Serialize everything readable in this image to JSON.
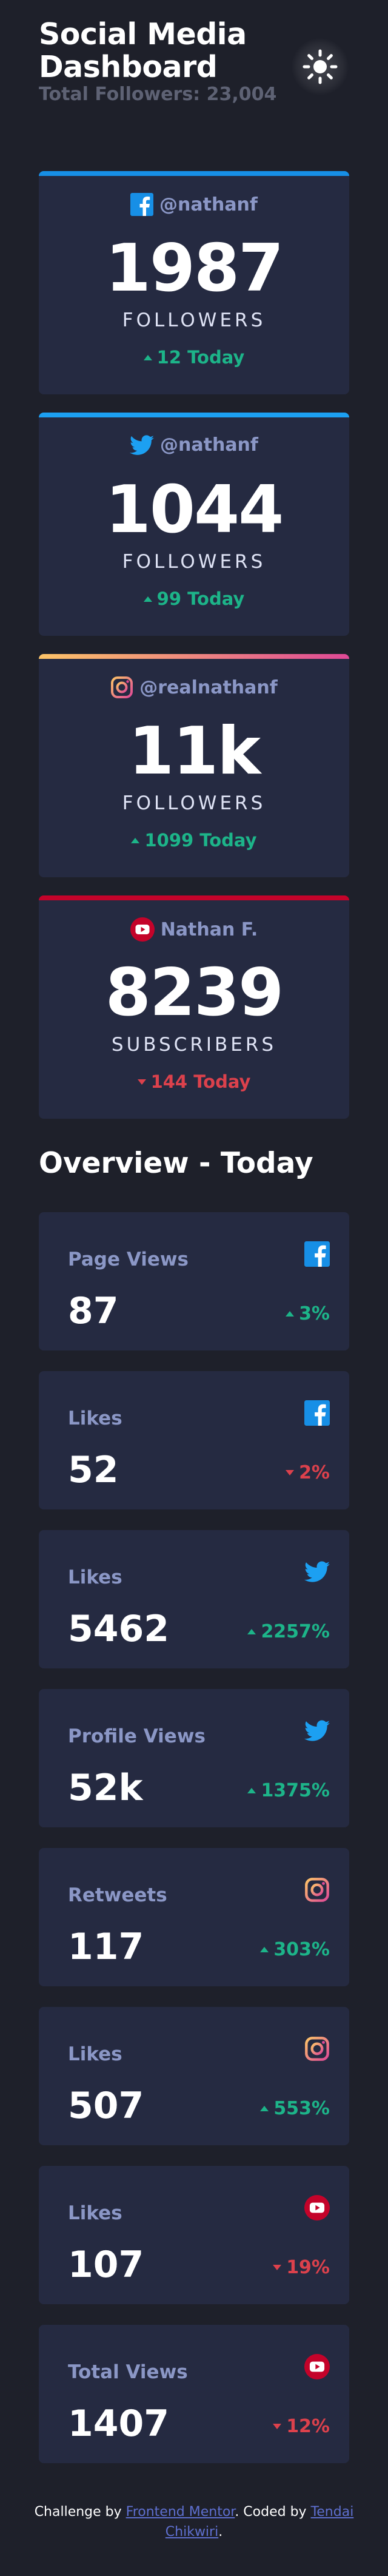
{
  "header": {
    "title": "Social Media Dashboard",
    "total_followers": "Total Followers: 23,004",
    "theme_icon": "sun-icon"
  },
  "brand_colors": {
    "facebook": "#178fe6",
    "twitter": "#1ca0f2",
    "instagram_from": "#fdc468",
    "instagram_to": "#df4996",
    "youtube": "#c4032a",
    "up": "#1db489",
    "down": "#dc414c"
  },
  "main_cards": [
    {
      "network": "facebook",
      "handle": "@nathanf",
      "count": "1987",
      "unit": "FOLLOWERS",
      "delta": "12 Today",
      "trend": "up",
      "icon": "facebook-icon"
    },
    {
      "network": "twitter",
      "handle": "@nathanf",
      "count": "1044",
      "unit": "FOLLOWERS",
      "delta": "99 Today",
      "trend": "up",
      "icon": "twitter-icon"
    },
    {
      "network": "instagram",
      "handle": "@realnathanf",
      "count": "11k",
      "unit": "FOLLOWERS",
      "delta": "1099 Today",
      "trend": "up",
      "icon": "instagram-icon"
    },
    {
      "network": "youtube",
      "handle": "Nathan F.",
      "count": "8239",
      "unit": "SUBSCRIBERS",
      "delta": "144 Today",
      "trend": "down",
      "icon": "youtube-icon"
    }
  ],
  "overview": {
    "title": "Overview - Today",
    "cards": [
      {
        "label": "Page Views",
        "value": "87",
        "delta": "3%",
        "trend": "up",
        "icon": "facebook-icon"
      },
      {
        "label": "Likes",
        "value": "52",
        "delta": "2%",
        "trend": "down",
        "icon": "facebook-icon"
      },
      {
        "label": "Likes",
        "value": "5462",
        "delta": "2257%",
        "trend": "up",
        "icon": "twitter-icon"
      },
      {
        "label": "Profile Views",
        "value": "52k",
        "delta": "1375%",
        "trend": "up",
        "icon": "twitter-icon"
      },
      {
        "label": "Retweets",
        "value": "117",
        "delta": "303%",
        "trend": "up",
        "icon": "instagram-icon"
      },
      {
        "label": "Likes",
        "value": "507",
        "delta": "553%",
        "trend": "up",
        "icon": "instagram-icon"
      },
      {
        "label": "Likes",
        "value": "107",
        "delta": "19%",
        "trend": "down",
        "icon": "youtube-icon"
      },
      {
        "label": "Total Views",
        "value": "1407",
        "delta": "12%",
        "trend": "down",
        "icon": "youtube-icon"
      }
    ]
  },
  "footer": {
    "prefix": "Challenge by ",
    "link1": "Frontend Mentor",
    "middle": ". Coded by ",
    "link2": "Tendai Chikwiri",
    "suffix": "."
  }
}
